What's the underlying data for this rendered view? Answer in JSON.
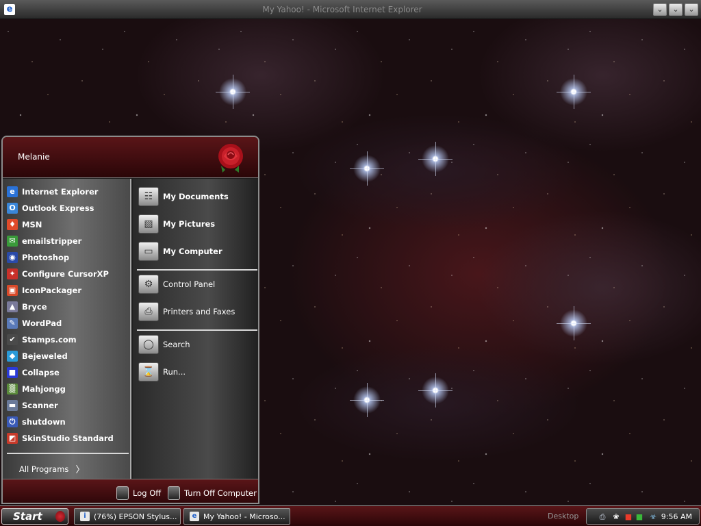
{
  "window": {
    "title": "My Yahoo! - Microsoft Internet Explorer",
    "app_icon": "e",
    "min_glyph": "⌄",
    "max_glyph": "⌄",
    "close_glyph": "⌄"
  },
  "start_menu": {
    "username": "Melanie",
    "programs": [
      {
        "label": "Internet Explorer",
        "icon": "ie-icon",
        "glyph": "e",
        "color": "#2a72d8"
      },
      {
        "label": "Outlook Express",
        "icon": "outlook-icon",
        "glyph": "O",
        "color": "#3a86d8"
      },
      {
        "label": "MSN",
        "icon": "msn-butterfly-icon",
        "glyph": "♦",
        "color": "#e04a2a"
      },
      {
        "label": "emailstripper",
        "icon": "envelope-icon",
        "glyph": "✉",
        "color": "#3a9a3a"
      },
      {
        "label": "Photoshop",
        "icon": "photoshop-icon",
        "glyph": "◉",
        "color": "#2a4aa8"
      },
      {
        "label": "Configure CursorXP",
        "icon": "cursorxp-icon",
        "glyph": "✦",
        "color": "#c8302a"
      },
      {
        "label": "IconPackager",
        "icon": "iconpackager-icon",
        "glyph": "▣",
        "color": "#d84a2a"
      },
      {
        "label": "Bryce",
        "icon": "bryce-icon",
        "glyph": "▲",
        "color": "#7a7a9a"
      },
      {
        "label": "WordPad",
        "icon": "wordpad-icon",
        "glyph": "✎",
        "color": "#5a7ab8"
      },
      {
        "label": "Stamps.com",
        "icon": "stamps-icon",
        "glyph": "✔",
        "color": "#4a4a4a"
      },
      {
        "label": "Bejeweled",
        "icon": "gem-icon",
        "glyph": "◆",
        "color": "#2a9ad8"
      },
      {
        "label": "Collapse",
        "icon": "collapse-icon",
        "glyph": "■",
        "color": "#2a3ad8"
      },
      {
        "label": "Mahjongg",
        "icon": "mahjongg-icon",
        "glyph": "▒",
        "color": "#5a8a3a"
      },
      {
        "label": "Scanner",
        "icon": "scanner-icon",
        "glyph": "▬",
        "color": "#6a7a9a"
      },
      {
        "label": "shutdown",
        "icon": "shutdown-icon",
        "glyph": "⏻",
        "color": "#3a5ab8"
      },
      {
        "label": "SkinStudio Standard",
        "icon": "skinstudio-icon",
        "glyph": "◩",
        "color": "#c83a2a"
      }
    ],
    "all_programs": "All Programs",
    "all_programs_arrow": "〉",
    "places": [
      {
        "label": "My Documents",
        "icon": "documents-icon",
        "glyph": "☷",
        "bold": true
      },
      {
        "label": "My Pictures",
        "icon": "pictures-icon",
        "glyph": "▨",
        "bold": true
      },
      {
        "label": "My Computer",
        "icon": "computer-icon",
        "glyph": "▭",
        "bold": true
      }
    ],
    "system": [
      {
        "label": "Control Panel",
        "icon": "control-panel-icon",
        "glyph": "⚙"
      },
      {
        "label": "Printers and Faxes",
        "icon": "printer-icon",
        "glyph": "⎙"
      }
    ],
    "tools": [
      {
        "label": "Search",
        "icon": "search-icon",
        "glyph": "◯"
      },
      {
        "label": "Run...",
        "icon": "run-icon",
        "glyph": "⌛"
      }
    ],
    "log_off": "Log Off",
    "turn_off": "Turn Off Computer"
  },
  "taskbar": {
    "start_label": "Start",
    "tasks": [
      {
        "label": "(76%) EPSON Stylus...",
        "icon": "printer-queue-icon",
        "glyph": "i"
      },
      {
        "label": "My Yahoo! - Microso...",
        "icon": "ie-icon",
        "glyph": "e"
      }
    ],
    "desktop_toolbar": "Desktop",
    "clock": "9:56 AM",
    "tray": [
      {
        "icon": "printer-tray-icon",
        "glyph": "⎙",
        "color": "#cfd8e8"
      },
      {
        "icon": "wolf-tray-icon",
        "glyph": "❀",
        "color": "#ffffff"
      },
      {
        "icon": "colors-tray-icon",
        "glyph": "■",
        "color": "#e83a2a"
      },
      {
        "icon": "blocks-tray-icon",
        "glyph": "■",
        "color": "#3ab83a"
      },
      {
        "icon": "network-tray-icon",
        "glyph": "☣",
        "color": "#8ac8f0"
      }
    ]
  },
  "colors": {
    "accent": "#5a1518",
    "menu_gray": "#6e6e6e"
  }
}
